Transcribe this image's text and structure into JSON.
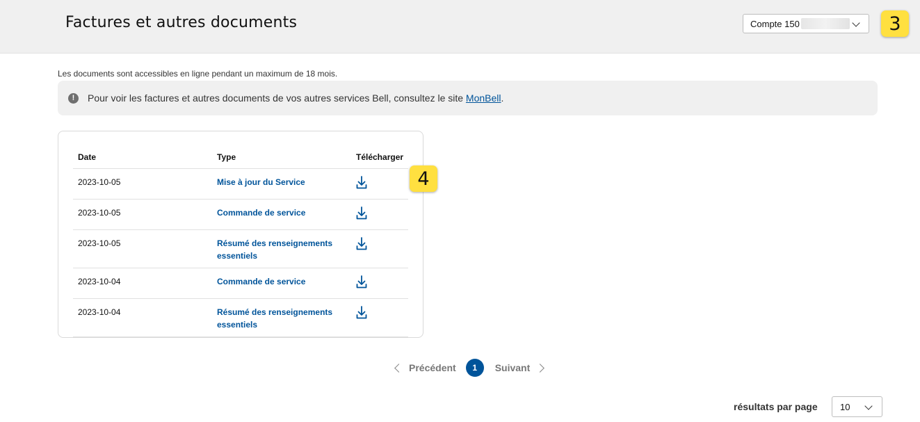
{
  "header": {
    "title": "Factures et autres documents",
    "account_select": {
      "label": "Compte 150"
    },
    "badge": "3"
  },
  "notice": "Les documents sont accessibles en ligne pendant un maximum de 18 mois.",
  "info": {
    "icon": "info-icon",
    "text": "Pour voir les factures et autres documents de vos autres services Bell, consultez le site ",
    "link": "MonBell",
    "suffix": "."
  },
  "table": {
    "headers": {
      "date": "Date",
      "type": "Type",
      "download": "Télécharger"
    },
    "rows": [
      {
        "date": "2023-10-05",
        "type": [
          "Mise à jour du Service"
        ]
      },
      {
        "date": "2023-10-05",
        "type": [
          "Commande de service"
        ]
      },
      {
        "date": "2023-10-05",
        "type": [
          "Résumé des renseignements",
          "essentiels"
        ]
      },
      {
        "date": "2023-10-04",
        "type": [
          "Commande de service"
        ]
      },
      {
        "date": "2023-10-04",
        "type": [
          "Résumé des renseignements",
          "essentiels"
        ]
      }
    ],
    "badge": "4"
  },
  "pagination": {
    "prev": "Précédent",
    "current": "1",
    "next": "Suivant"
  },
  "per_page": {
    "label": "résultats par page",
    "value": "10"
  },
  "colors": {
    "accent": "#00549a",
    "header_bg": "#f0f0f0",
    "badge": "#ffe040"
  }
}
